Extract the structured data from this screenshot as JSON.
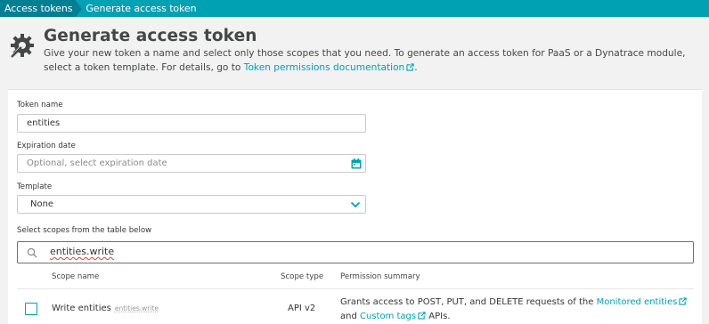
{
  "breadcrumb": {
    "items": [
      "Access tokens",
      "Generate access token"
    ]
  },
  "header": {
    "title": "Generate access token",
    "description_before_link": "Give your new token a name and select only those scopes that you need. To generate an access token for PaaS or a Dynatrace module, select a token template. For details, go to ",
    "link_text": "Token permissions documentation",
    "description_after_link": "."
  },
  "form": {
    "token_name": {
      "label": "Token name",
      "value": "entities"
    },
    "expiration": {
      "label": "Expiration date",
      "placeholder": "Optional, select expiration date"
    },
    "template": {
      "label": "Template",
      "selected": "None"
    },
    "scopes_label": "Select scopes from the table below",
    "search": {
      "value": "entities.write"
    }
  },
  "table": {
    "headers": {
      "scope_name": "Scope name",
      "scope_type": "Scope type",
      "permission": "Permission summary"
    },
    "rows": [
      {
        "checked": false,
        "name": "Write entities",
        "scope_id": "entities.write",
        "type": "API v2",
        "perm_before": "Grants access to POST, PUT, and DELETE requests of the ",
        "perm_link1": "Monitored entities",
        "perm_middle": " and ",
        "perm_link2": "Custom tags",
        "perm_after": " APIs."
      }
    ]
  },
  "colors": {
    "accent": "#00a1b2",
    "breadcrumb_dark": "#007f93",
    "text": "#353535"
  },
  "icons": [
    "gear-tool-icon",
    "external-link-icon",
    "calendar-icon",
    "chevron-down-icon",
    "search-icon"
  ]
}
